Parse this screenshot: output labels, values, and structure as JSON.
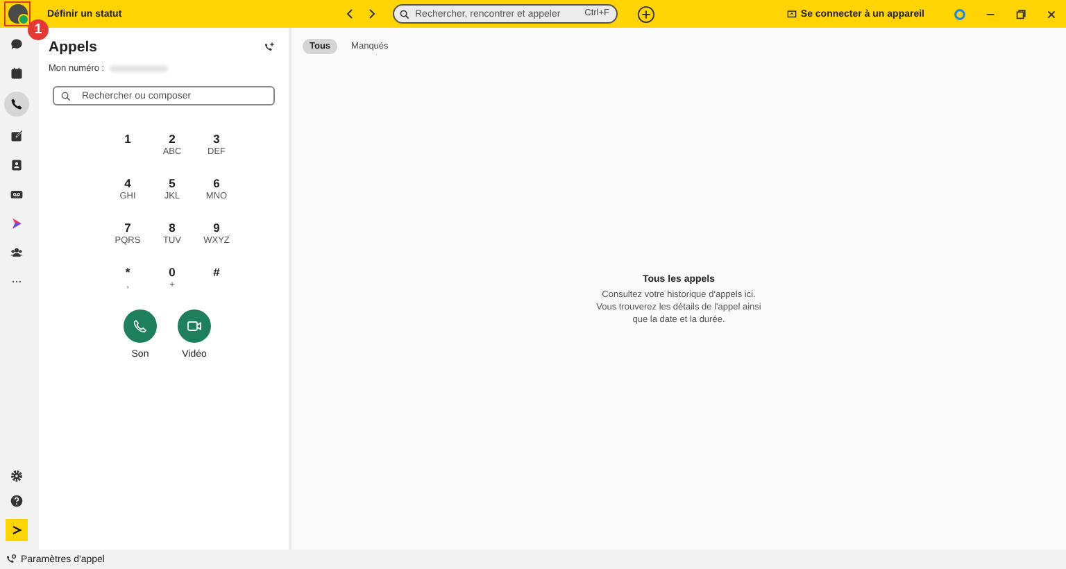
{
  "top_bar": {
    "status": "Définir un statut",
    "search": {
      "placeholder": "Rechercher, rencontrer et appeler",
      "shortcut": "Ctrl+F"
    },
    "connect": "Se connecter à un appareil"
  },
  "annotation": {
    "badge": "1"
  },
  "rail": {
    "items": [
      {
        "kind": "chat",
        "selected": false
      },
      {
        "kind": "calendar",
        "selected": false
      },
      {
        "kind": "phone",
        "selected": true
      },
      {
        "kind": "note",
        "selected": false
      },
      {
        "kind": "contacts",
        "selected": false
      },
      {
        "kind": "voicemail",
        "selected": false
      },
      {
        "kind": "play",
        "selected": false
      },
      {
        "kind": "people",
        "selected": false
      },
      {
        "kind": "more",
        "selected": false
      }
    ],
    "bottom": [
      {
        "kind": "settings"
      },
      {
        "kind": "help"
      },
      {
        "kind": "launch"
      }
    ]
  },
  "panel": {
    "title": "Appels",
    "number_label": "Mon numéro :",
    "search": {
      "placeholder": "Rechercher ou composer"
    },
    "keys": [
      {
        "digit": "1"
      },
      {
        "digit": "2",
        "letters": "ABC"
      },
      {
        "digit": "3",
        "letters": "DEF"
      },
      {
        "digit": "4",
        "letters": "GHI"
      },
      {
        "digit": "5",
        "letters": "JKL"
      },
      {
        "digit": "6",
        "letters": "MNO"
      },
      {
        "digit": "7",
        "letters": "PQRS"
      },
      {
        "digit": "8",
        "letters": "TUV"
      },
      {
        "digit": "9",
        "letters": "WXYZ"
      },
      {
        "digit": "*",
        "letters": ","
      },
      {
        "digit": "0",
        "letters": "+"
      },
      {
        "digit": "#"
      }
    ],
    "call_buttons": [
      {
        "kind": "audio",
        "label": "Son"
      },
      {
        "kind": "video",
        "label": "Vidéo"
      }
    ]
  },
  "tabs": [
    {
      "label": "Tous",
      "selected": true
    },
    {
      "label": "Manqués",
      "selected": false
    }
  ],
  "empty_state": {
    "title": "Tous les appels",
    "text": "Consultez votre historique d'appels ici. Vous trouverez les détails de l'appel ainsi que la date et la durée."
  },
  "footer": {
    "label": "Paramètres d'appel"
  }
}
